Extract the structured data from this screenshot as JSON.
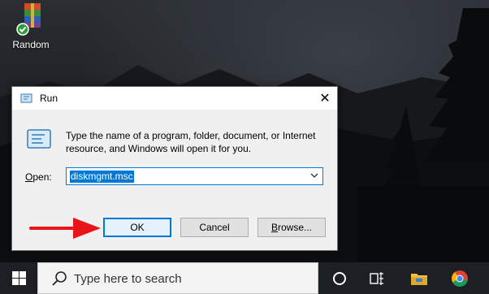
{
  "desktop": {
    "icon_label": "Random"
  },
  "run_dialog": {
    "title": "Run",
    "description": "Type the name of a program, folder, document, or Internet resource, and Windows will open it for you.",
    "open_label_prefix": "",
    "open_label_accel": "O",
    "open_label_rest": "pen:",
    "open_value": "diskmgmt.msc",
    "ok_label": "OK",
    "cancel_label": "Cancel",
    "browse_label_accel": "B",
    "browse_label_rest": "rowse..."
  },
  "taskbar": {
    "search_placeholder": "Type here to search"
  },
  "colors": {
    "accent": "#0078d7",
    "arrow": "#e8141a",
    "taskbar": "#1c1f24"
  }
}
